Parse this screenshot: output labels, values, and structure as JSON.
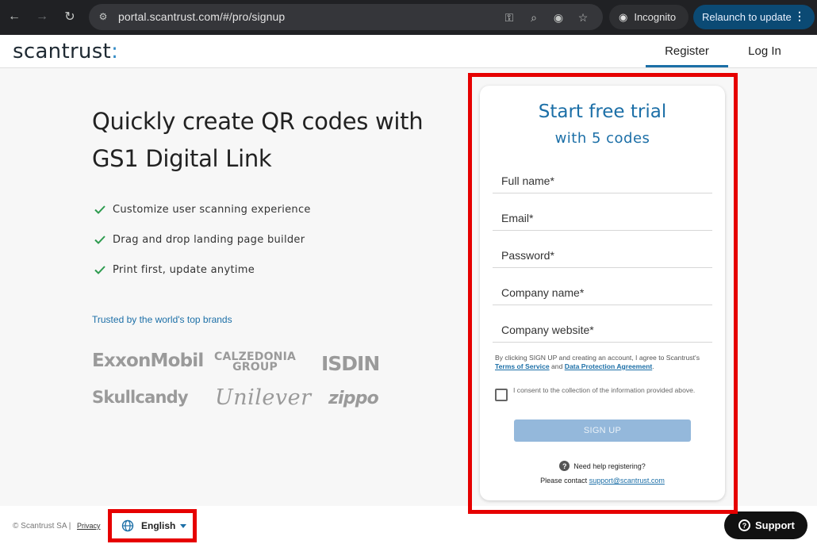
{
  "browser": {
    "url": "portal.scantrust.com/#/pro/signup",
    "incognito_label": "Incognito",
    "relaunch_label": "Relaunch to update"
  },
  "header": {
    "logo_text": "scantrust",
    "logo_colon": ":",
    "tabs": [
      {
        "label": "Register",
        "active": true
      },
      {
        "label": "Log In",
        "active": false
      }
    ]
  },
  "hero": {
    "headline": "Quickly create QR codes with GS1 Digital Link",
    "features": [
      "Customize user scanning experience",
      "Drag and drop landing page builder",
      "Print first, update anytime"
    ],
    "trusted_label": "Trusted by the world's top brands",
    "brands": [
      "ExxonMobil",
      "CALZEDONIA GROUP",
      "ISDIN",
      "Skullcandy",
      "Unilever",
      "zippo"
    ]
  },
  "signup": {
    "title": "Start free trial",
    "subtitle": "with 5 codes",
    "fields": [
      {
        "label": "Full name*",
        "value": ""
      },
      {
        "label": "Email*",
        "value": ""
      },
      {
        "label": "Password*",
        "value": ""
      },
      {
        "label": "Company name*",
        "value": ""
      },
      {
        "label": "Company website*",
        "value": ""
      }
    ],
    "terms_prefix": "By clicking SIGN UP and creating an account, I agree to Scantrust's",
    "terms_link": "Terms of Service",
    "terms_and": "and",
    "dpa_link": "Data Protection Agreement",
    "terms_suffix": ".",
    "consent_text": "I consent to the collection of the information provided above.",
    "consent_checked": false,
    "submit_label": "SIGN UP",
    "help_text": "Need help registering?",
    "contact_prefix": "Please contact",
    "contact_email": "support@scantrust.com"
  },
  "footer": {
    "copyright": "© Scantrust SA |",
    "privacy": "Privacy",
    "language": "English",
    "support_label": "Support"
  },
  "colors": {
    "brand_blue": "#1c6fa7",
    "highlight_red": "#e60000",
    "check_green": "#2e9b4f"
  }
}
